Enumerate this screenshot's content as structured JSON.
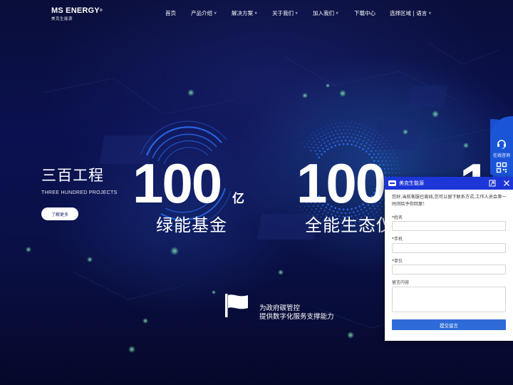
{
  "brand": {
    "name": "MS ENERGY",
    "sub": "美克生能源"
  },
  "nav": {
    "items": [
      {
        "label": "首页",
        "has_chevron": false
      },
      {
        "label": "产品介绍",
        "has_chevron": true
      },
      {
        "label": "解决方案",
        "has_chevron": true
      },
      {
        "label": "关于我们",
        "has_chevron": true
      },
      {
        "label": "加入我们",
        "has_chevron": true
      },
      {
        "label": "下载中心",
        "has_chevron": false
      },
      {
        "label": "选择区域 | 语言",
        "has_chevron": true
      }
    ]
  },
  "hero": {
    "title": "三百工程",
    "subtitle": "THREE HUNDRED PROJECTS",
    "button": "了解更多"
  },
  "stats": [
    {
      "number": "100",
      "unit": "亿",
      "caption": "绿能基金"
    },
    {
      "number": "100",
      "unit": "",
      "caption": "全能生态仪"
    },
    {
      "number": "1",
      "unit": "",
      "caption": ""
    }
  ],
  "feature": {
    "line1": "为政府碳管控",
    "line2": "提供数字化服务支撑能力"
  },
  "side_contact": {
    "label": "在线咨询",
    "icons": [
      "headset-icon",
      "qr-code-icon",
      "person-icon"
    ]
  },
  "chat": {
    "title": "美克生能源",
    "message": "您好,当前客服已离线,您可以留下联系方式,工作人员会第一时间给予你回复！",
    "fields": [
      {
        "label": "*姓名",
        "placeholder": ""
      },
      {
        "label": "*手机",
        "placeholder": ""
      },
      {
        "label": "*单位",
        "placeholder": ""
      }
    ],
    "textarea_label": "留言内容",
    "submit": "提交留言"
  },
  "colors": {
    "background": "#0b1150",
    "accent_blue": "#1a55d8",
    "chat_header": "#1c36d8",
    "submit_button": "#2e6bd8",
    "ring_blue": "#2a6df0"
  }
}
